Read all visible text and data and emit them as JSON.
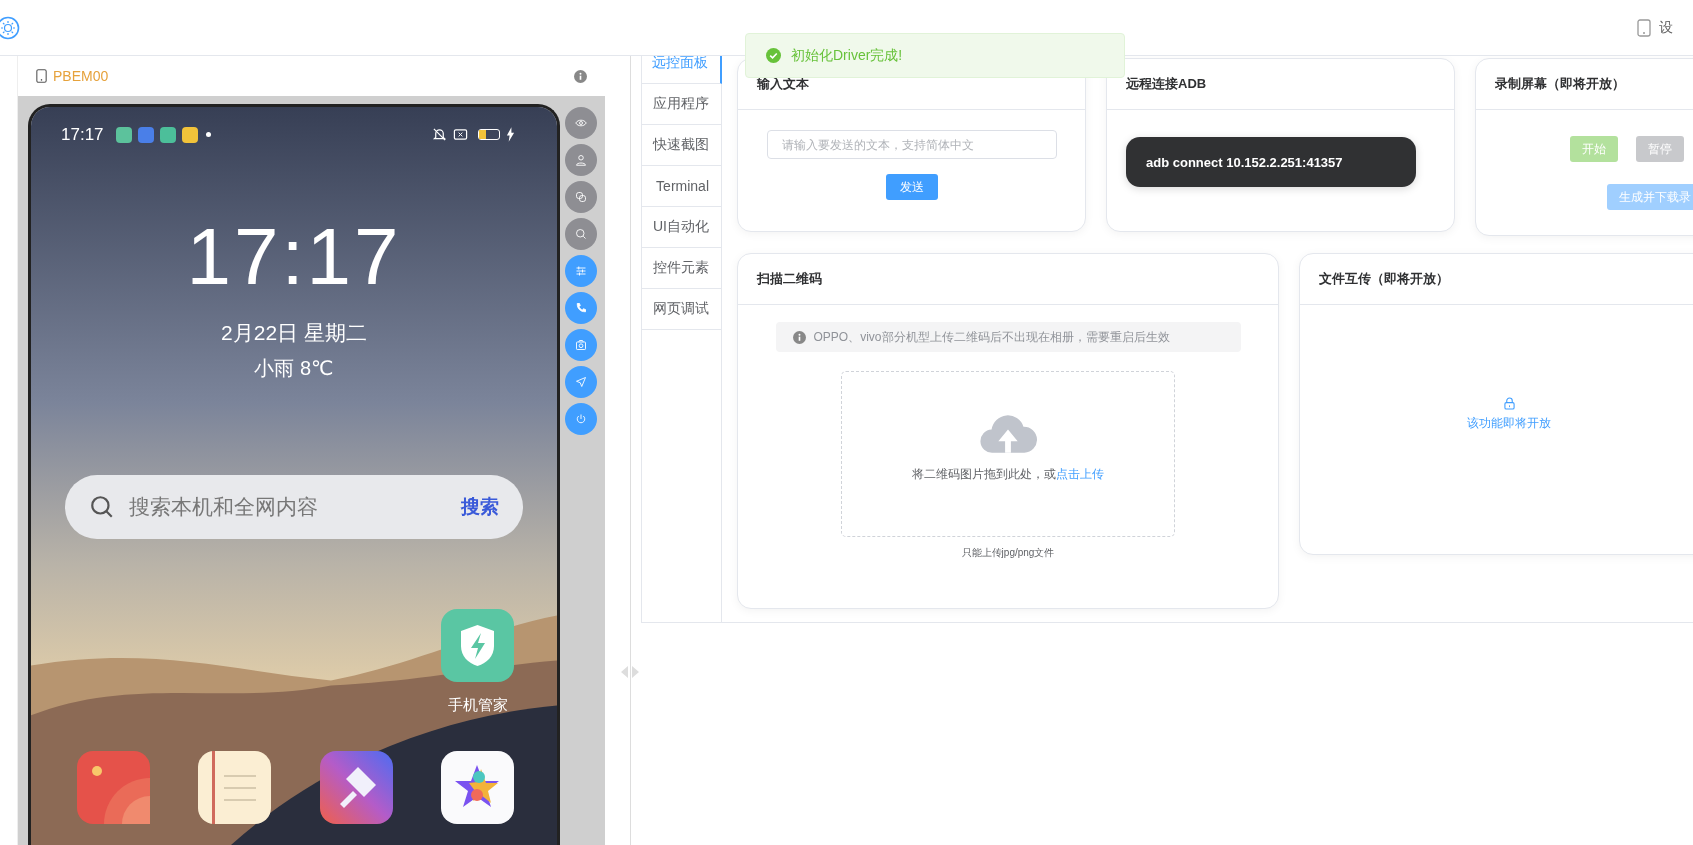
{
  "header": {
    "device_label": "设"
  },
  "toast": {
    "kind": "success",
    "text": "初始化Driver完成!"
  },
  "device_panel": {
    "model": "PBEM00",
    "phone": {
      "status_time": "17:17",
      "status_icons": [
        {
          "color": "#5cc29c"
        },
        {
          "color": "#4a7fe8"
        },
        {
          "color": "#4cbf9a"
        },
        {
          "color": "#f2c33a"
        }
      ],
      "clock": "17:17",
      "date": "2月22日 星期二",
      "weather": "小雨 8℃",
      "search": {
        "text": "搜索本机和全网内容",
        "button": "搜索"
      },
      "apps": [
        {
          "kind": "shield",
          "label": "手机管家"
        },
        {
          "kind": "gallery"
        },
        {
          "kind": "notes"
        },
        {
          "kind": "theme"
        },
        {
          "kind": "game"
        }
      ]
    },
    "side_buttons": [
      {
        "kind": "eye",
        "disabled": true
      },
      {
        "kind": "user",
        "disabled": true
      },
      {
        "kind": "link",
        "disabled": true
      },
      {
        "kind": "search",
        "disabled": true
      },
      {
        "kind": "sliders",
        "disabled": false
      },
      {
        "kind": "phone",
        "disabled": false
      },
      {
        "kind": "camera",
        "disabled": false
      },
      {
        "kind": "navigate",
        "disabled": false
      },
      {
        "kind": "power",
        "disabled": false
      }
    ]
  },
  "tabs": [
    {
      "label": "远控面板",
      "selected": true
    },
    {
      "label": "应用程序",
      "selected": false
    },
    {
      "label": "快速截图",
      "selected": false
    },
    {
      "label": "Terminal",
      "selected": false
    },
    {
      "label": "UI自动化",
      "selected": false
    },
    {
      "label": "控件元素",
      "selected": false
    },
    {
      "label": "网页调试",
      "selected": false
    }
  ],
  "input_card": {
    "title": "输入文本",
    "placeholder": "请输入要发送的文本，支持简体中文",
    "button": "发送"
  },
  "adb_card": {
    "title": "远程连接ADB",
    "command": "adb connect 10.152.2.251:41357"
  },
  "record_card": {
    "title": "录制屏幕（即将开放）",
    "buttons": [
      {
        "kind": "start",
        "label": "开始"
      },
      {
        "kind": "pause",
        "label": "暂停"
      },
      {
        "kind": "download",
        "label": "生成并下载录"
      }
    ]
  },
  "qr_card": {
    "title": "扫描二维码",
    "notice": "OPPO、vivo部分机型上传二维码后不出现在相册，需要重启后生效",
    "drop_text": "将二维码图片拖到此处，或",
    "drop_link": "点击上传",
    "tip": "只能上传jpg/png文件"
  },
  "file_card": {
    "title": "文件互传（即将开放）",
    "message": "该功能即将开放"
  }
}
